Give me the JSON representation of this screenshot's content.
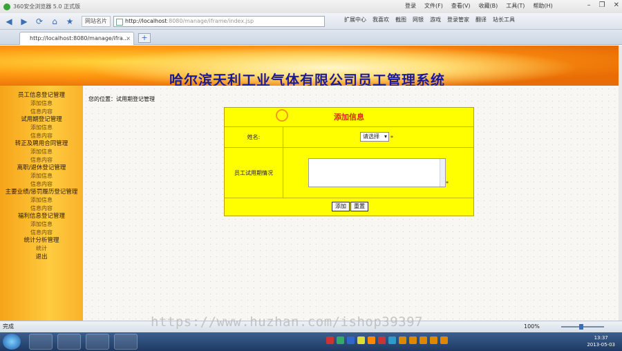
{
  "browser": {
    "window_title": "360安全浏览器 5.0 正式版",
    "menus": [
      "登录",
      "文件(F)",
      "查看(V)",
      "收藏(B)",
      "工具(T)",
      "帮助(H)"
    ],
    "favorites_label": "网站名片",
    "address": "http://localhost:8080/manage/iframe/index.jsp",
    "address_host": "http://localhost",
    "address_rest": ":8080/manage/iframe/index.jsp",
    "toolbar_items": [
      "扩展中心",
      "我喜欢",
      "截图",
      "网银",
      "游戏",
      "登录管家",
      "翻译",
      "站长工具"
    ],
    "tab_label": "http://localhost:8080/manage/ifra...",
    "status_left": "完成",
    "zoom": "100%"
  },
  "site": {
    "title": "哈尔滨天利工业气体有限公司员工管理系统",
    "breadcrumb": "您的位置：试用期登记管理"
  },
  "sidebar": {
    "groups": [
      {
        "title": "员工信息登记管理",
        "items": [
          "添加信息",
          "信息内容"
        ]
      },
      {
        "title": "试用期登记管理",
        "items": [
          "添加信息",
          "信息内容"
        ]
      },
      {
        "title": "转正及聘用合同管理",
        "items": [
          "添加信息",
          "信息内容"
        ]
      },
      {
        "title": "离职/退休登记管理",
        "items": [
          "添加信息",
          "信息内容"
        ]
      },
      {
        "title": "主要业绩/惩罚履历登记管理",
        "items": [
          "添加信息",
          "信息内容"
        ]
      },
      {
        "title": "福利信息登记管理",
        "items": [
          "添加信息",
          "信息内容"
        ]
      },
      {
        "title": "统计分析管理",
        "items": [
          "统计"
        ]
      }
    ],
    "exit_label": "退出"
  },
  "form": {
    "header": "添加信息",
    "name_label": "姓名:",
    "name_select": "请选择",
    "trial_label": "员工试用期情况",
    "required_mark": "*",
    "submit_label": "添加",
    "reset_label": "重置"
  },
  "watermark": "https://www.huzhan.com/ishop39397",
  "taskbar": {
    "clock_time": "13:37",
    "clock_date": "2013-05-03"
  }
}
